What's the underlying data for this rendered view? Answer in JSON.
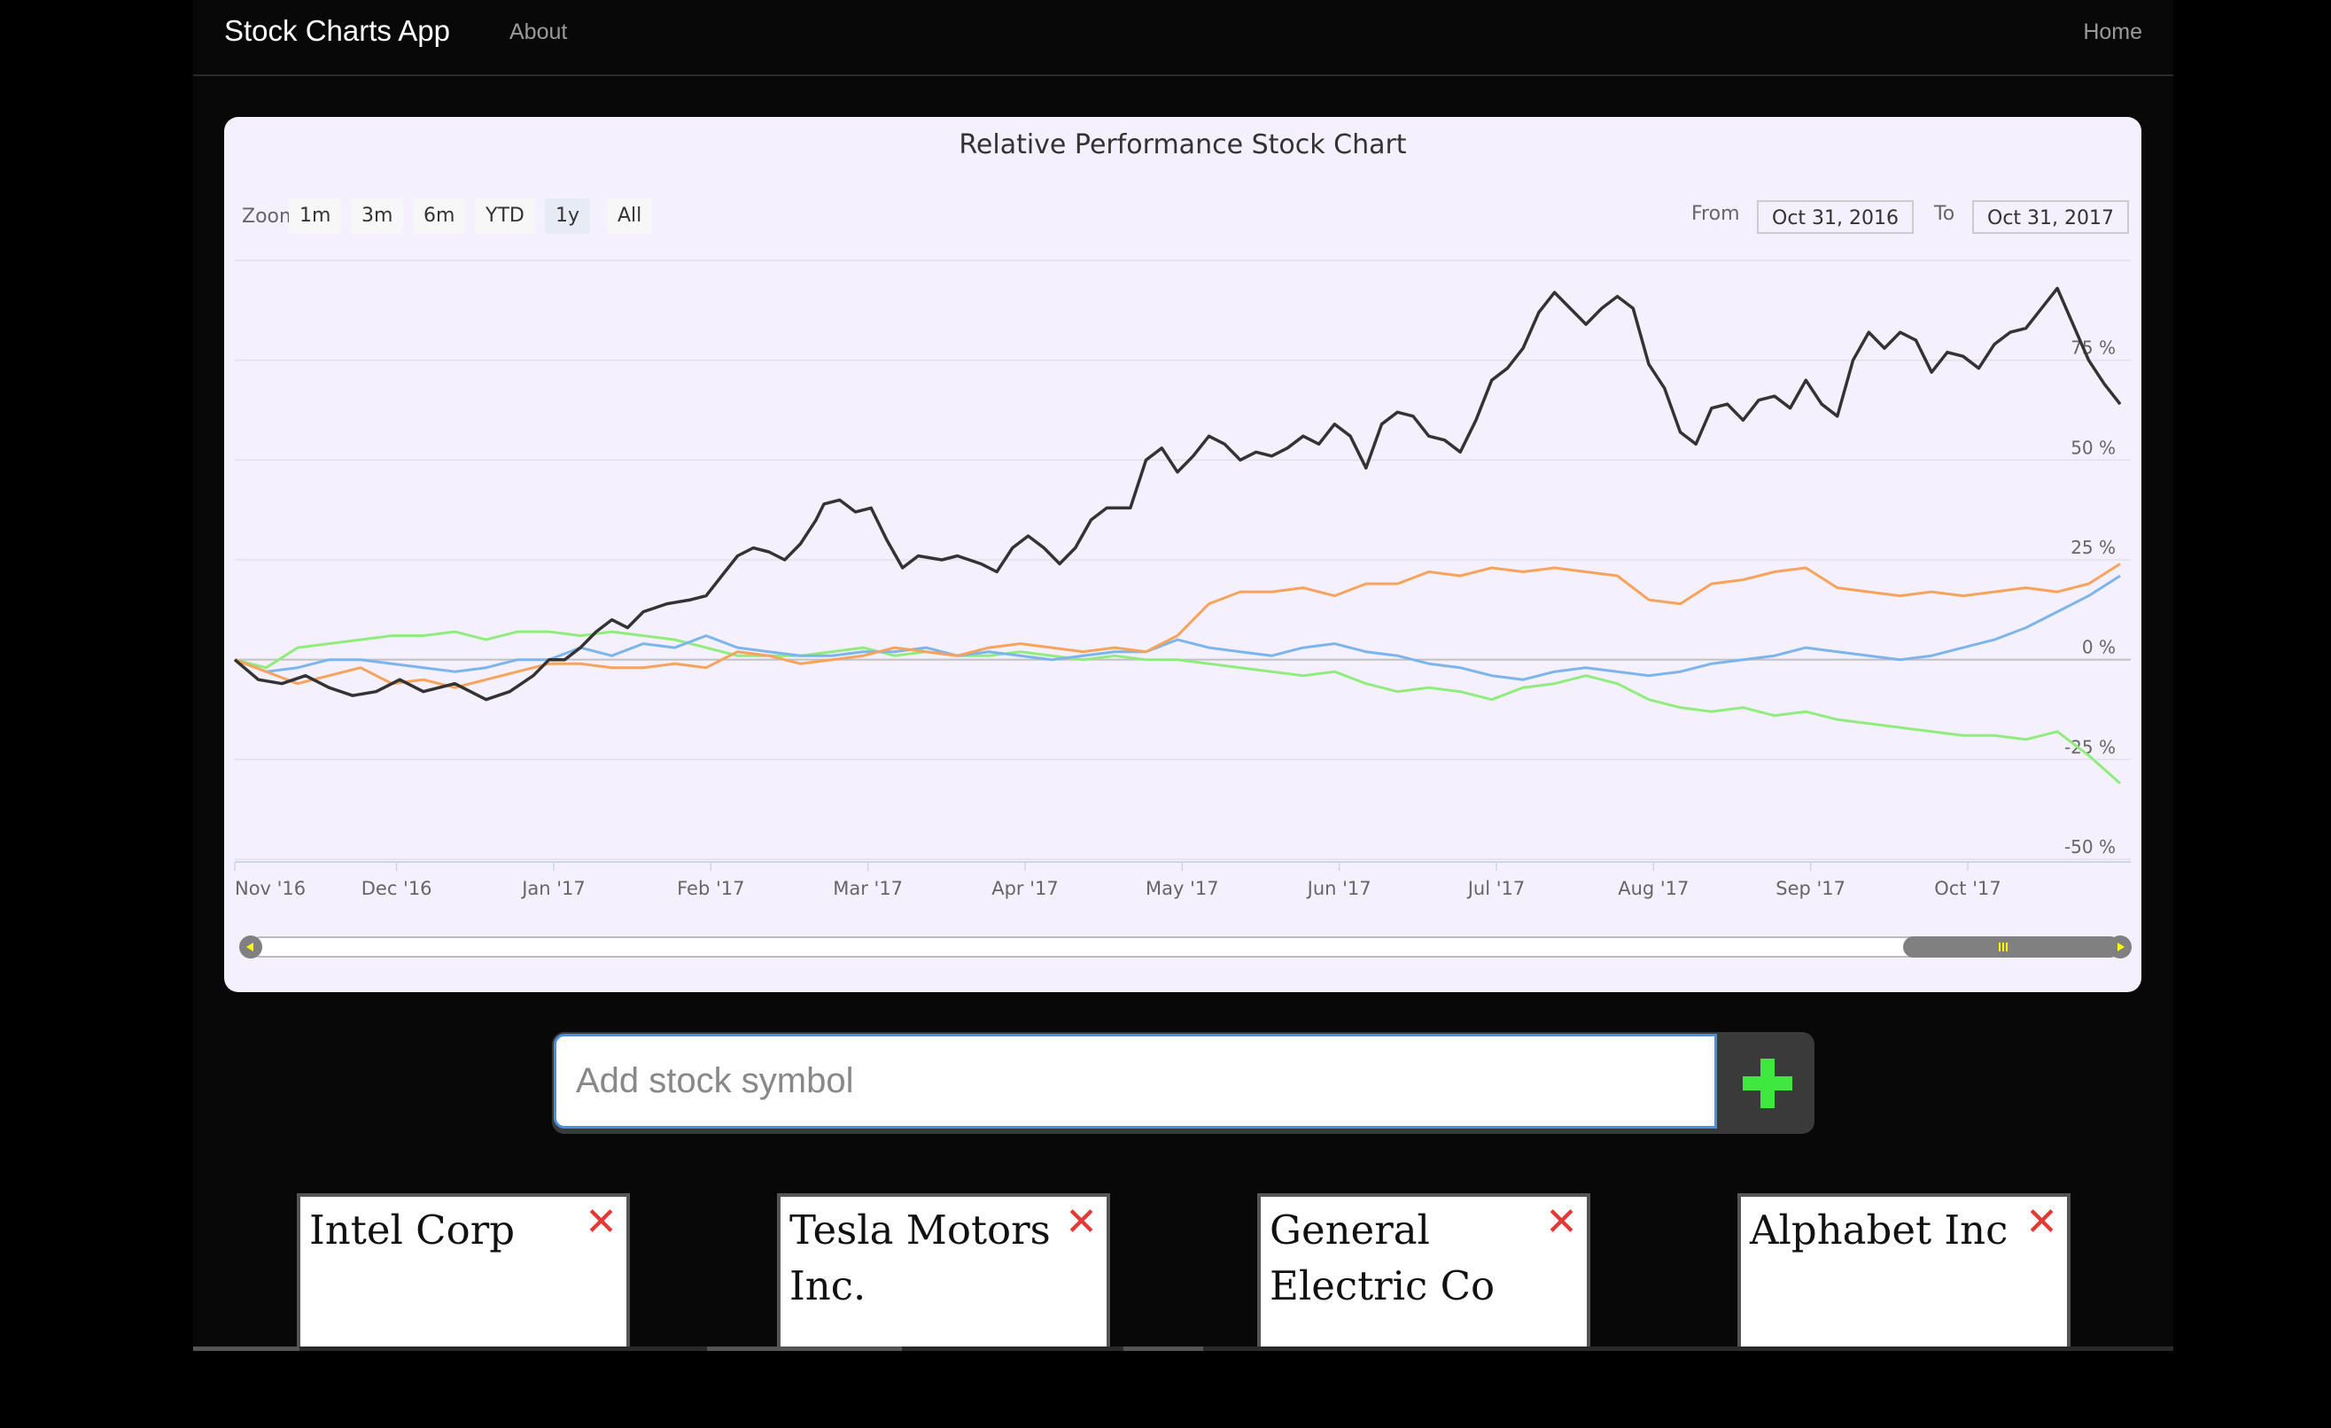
{
  "navbar": {
    "brand": "Stock Charts App",
    "about": "About",
    "home": "Home"
  },
  "chart": {
    "title": "Relative Performance Stock Chart",
    "zoom_label": "Zoom",
    "zoom_buttons": [
      "1m",
      "3m",
      "6m",
      "YTD",
      "1y",
      "All"
    ],
    "active_zoom": "1y",
    "from_label": "From",
    "from_date": "Oct 31, 2016",
    "to_label": "To",
    "to_date": "Oct 31, 2017"
  },
  "chart_data": {
    "type": "line",
    "title": "Relative Performance Stock Chart",
    "x_tick_labels": [
      "Nov '16",
      "Dec '16",
      "Jan '17",
      "Feb '17",
      "Mar '17",
      "Apr '17",
      "May '17",
      "Jun '17",
      "Jul '17",
      "Aug '17",
      "Sep '17",
      "Oct '17"
    ],
    "y_tick_labels": [
      "-50 %",
      "-25 %",
      "0 %",
      "25 %",
      "50 %",
      "75 %"
    ],
    "ylim": [
      -50,
      100
    ],
    "x_unit": "months since Oct 31, 2016",
    "grid": true,
    "series": [
      {
        "color": "#333333",
        "points": [
          [
            0,
            0
          ],
          [
            0.15,
            -5
          ],
          [
            0.3,
            -6
          ],
          [
            0.45,
            -4
          ],
          [
            0.6,
            -7
          ],
          [
            0.75,
            -9
          ],
          [
            0.9,
            -8
          ],
          [
            1.05,
            -5
          ],
          [
            1.2,
            -8
          ],
          [
            1.4,
            -6
          ],
          [
            1.6,
            -10
          ],
          [
            1.75,
            -8
          ],
          [
            1.9,
            -4
          ],
          [
            2.0,
            0
          ],
          [
            2.1,
            0
          ],
          [
            2.2,
            3
          ],
          [
            2.3,
            7
          ],
          [
            2.4,
            10
          ],
          [
            2.5,
            8
          ],
          [
            2.6,
            12
          ],
          [
            2.75,
            14
          ],
          [
            2.9,
            15
          ],
          [
            3.0,
            16
          ],
          [
            3.1,
            21
          ],
          [
            3.2,
            26
          ],
          [
            3.3,
            28
          ],
          [
            3.4,
            27
          ],
          [
            3.5,
            25
          ],
          [
            3.6,
            29
          ],
          [
            3.7,
            35
          ],
          [
            3.75,
            39
          ],
          [
            3.85,
            40
          ],
          [
            3.95,
            37
          ],
          [
            4.05,
            38
          ],
          [
            4.15,
            30
          ],
          [
            4.25,
            23
          ],
          [
            4.35,
            26
          ],
          [
            4.5,
            25
          ],
          [
            4.6,
            26
          ],
          [
            4.75,
            24
          ],
          [
            4.85,
            22
          ],
          [
            4.95,
            28
          ],
          [
            5.05,
            31
          ],
          [
            5.15,
            28
          ],
          [
            5.25,
            24
          ],
          [
            5.35,
            28
          ],
          [
            5.45,
            35
          ],
          [
            5.55,
            38
          ],
          [
            5.7,
            38
          ],
          [
            5.8,
            50
          ],
          [
            5.9,
            53
          ],
          [
            6.0,
            47
          ],
          [
            6.1,
            51
          ],
          [
            6.2,
            56
          ],
          [
            6.3,
            54
          ],
          [
            6.4,
            50
          ],
          [
            6.5,
            52
          ],
          [
            6.6,
            51
          ],
          [
            6.7,
            53
          ],
          [
            6.8,
            56
          ],
          [
            6.9,
            54
          ],
          [
            7.0,
            59
          ],
          [
            7.1,
            56
          ],
          [
            7.2,
            48
          ],
          [
            7.3,
            59
          ],
          [
            7.4,
            62
          ],
          [
            7.5,
            61
          ],
          [
            7.6,
            56
          ],
          [
            7.7,
            55
          ],
          [
            7.8,
            52
          ],
          [
            7.9,
            60
          ],
          [
            8.0,
            70
          ],
          [
            8.1,
            73
          ],
          [
            8.2,
            78
          ],
          [
            8.3,
            87
          ],
          [
            8.4,
            92
          ],
          [
            8.5,
            88
          ],
          [
            8.6,
            84
          ],
          [
            8.7,
            88
          ],
          [
            8.8,
            91
          ],
          [
            8.9,
            88
          ],
          [
            9.0,
            74
          ],
          [
            9.1,
            68
          ],
          [
            9.2,
            57
          ],
          [
            9.3,
            54
          ],
          [
            9.4,
            63
          ],
          [
            9.5,
            64
          ],
          [
            9.6,
            60
          ],
          [
            9.7,
            65
          ],
          [
            9.8,
            66
          ],
          [
            9.9,
            63
          ],
          [
            10.0,
            70
          ],
          [
            10.1,
            64
          ],
          [
            10.2,
            61
          ],
          [
            10.3,
            75
          ],
          [
            10.4,
            82
          ],
          [
            10.5,
            78
          ],
          [
            10.6,
            82
          ],
          [
            10.7,
            80
          ],
          [
            10.8,
            72
          ],
          [
            10.9,
            77
          ],
          [
            11.0,
            76
          ],
          [
            11.1,
            73
          ],
          [
            11.2,
            79
          ],
          [
            11.3,
            82
          ],
          [
            11.4,
            83
          ],
          [
            11.5,
            88
          ],
          [
            11.6,
            93
          ],
          [
            11.7,
            84
          ],
          [
            11.8,
            75
          ],
          [
            11.9,
            69
          ],
          [
            12.0,
            64
          ]
        ]
      },
      {
        "color": "#f7a35c",
        "points": [
          [
            0,
            0
          ],
          [
            0.2,
            -3
          ],
          [
            0.4,
            -6
          ],
          [
            0.6,
            -4
          ],
          [
            0.8,
            -2
          ],
          [
            1.0,
            -6
          ],
          [
            1.2,
            -5
          ],
          [
            1.4,
            -7
          ],
          [
            1.6,
            -5
          ],
          [
            1.8,
            -3
          ],
          [
            2.0,
            -1
          ],
          [
            2.2,
            -1
          ],
          [
            2.4,
            -2
          ],
          [
            2.6,
            -2
          ],
          [
            2.8,
            -1
          ],
          [
            3.0,
            -2
          ],
          [
            3.2,
            2
          ],
          [
            3.4,
            1
          ],
          [
            3.6,
            -1
          ],
          [
            3.8,
            0
          ],
          [
            4.0,
            1
          ],
          [
            4.2,
            3
          ],
          [
            4.4,
            2
          ],
          [
            4.6,
            1
          ],
          [
            4.8,
            3
          ],
          [
            5.0,
            4
          ],
          [
            5.2,
            3
          ],
          [
            5.4,
            2
          ],
          [
            5.6,
            3
          ],
          [
            5.8,
            2
          ],
          [
            6.0,
            6
          ],
          [
            6.2,
            14
          ],
          [
            6.4,
            17
          ],
          [
            6.6,
            17
          ],
          [
            6.8,
            18
          ],
          [
            7.0,
            16
          ],
          [
            7.2,
            19
          ],
          [
            7.4,
            19
          ],
          [
            7.6,
            22
          ],
          [
            7.8,
            21
          ],
          [
            8.0,
            23
          ],
          [
            8.2,
            22
          ],
          [
            8.4,
            23
          ],
          [
            8.6,
            22
          ],
          [
            8.8,
            21
          ],
          [
            9.0,
            15
          ],
          [
            9.2,
            14
          ],
          [
            9.4,
            19
          ],
          [
            9.6,
            20
          ],
          [
            9.8,
            22
          ],
          [
            10.0,
            23
          ],
          [
            10.2,
            18
          ],
          [
            10.4,
            17
          ],
          [
            10.6,
            16
          ],
          [
            10.8,
            17
          ],
          [
            11.0,
            16
          ],
          [
            11.2,
            17
          ],
          [
            11.4,
            18
          ],
          [
            11.6,
            17
          ],
          [
            11.8,
            19
          ],
          [
            12.0,
            24
          ]
        ]
      },
      {
        "color": "#7cb5ec",
        "points": [
          [
            0,
            0
          ],
          [
            0.2,
            -3
          ],
          [
            0.4,
            -2
          ],
          [
            0.6,
            0
          ],
          [
            0.8,
            0
          ],
          [
            1.0,
            -1
          ],
          [
            1.2,
            -2
          ],
          [
            1.4,
            -3
          ],
          [
            1.6,
            -2
          ],
          [
            1.8,
            0
          ],
          [
            2.0,
            0
          ],
          [
            2.2,
            3
          ],
          [
            2.4,
            1
          ],
          [
            2.6,
            4
          ],
          [
            2.8,
            3
          ],
          [
            3.0,
            6
          ],
          [
            3.2,
            3
          ],
          [
            3.4,
            2
          ],
          [
            3.6,
            1
          ],
          [
            3.8,
            1
          ],
          [
            4.0,
            2
          ],
          [
            4.2,
            2
          ],
          [
            4.4,
            3
          ],
          [
            4.6,
            1
          ],
          [
            4.8,
            2
          ],
          [
            5.0,
            1
          ],
          [
            5.2,
            0
          ],
          [
            5.4,
            1
          ],
          [
            5.6,
            2
          ],
          [
            5.8,
            2
          ],
          [
            6.0,
            5
          ],
          [
            6.2,
            3
          ],
          [
            6.4,
            2
          ],
          [
            6.6,
            1
          ],
          [
            6.8,
            3
          ],
          [
            7.0,
            4
          ],
          [
            7.2,
            2
          ],
          [
            7.4,
            1
          ],
          [
            7.6,
            -1
          ],
          [
            7.8,
            -2
          ],
          [
            8.0,
            -4
          ],
          [
            8.2,
            -5
          ],
          [
            8.4,
            -3
          ],
          [
            8.6,
            -2
          ],
          [
            8.8,
            -3
          ],
          [
            9.0,
            -4
          ],
          [
            9.2,
            -3
          ],
          [
            9.4,
            -1
          ],
          [
            9.6,
            0
          ],
          [
            9.8,
            1
          ],
          [
            10.0,
            3
          ],
          [
            10.2,
            2
          ],
          [
            10.4,
            1
          ],
          [
            10.6,
            0
          ],
          [
            10.8,
            1
          ],
          [
            11.0,
            3
          ],
          [
            11.2,
            5
          ],
          [
            11.4,
            8
          ],
          [
            11.6,
            12
          ],
          [
            11.8,
            16
          ],
          [
            12.0,
            21
          ]
        ]
      },
      {
        "color": "#90ed7d",
        "points": [
          [
            0,
            0
          ],
          [
            0.2,
            -2
          ],
          [
            0.4,
            3
          ],
          [
            0.6,
            4
          ],
          [
            0.8,
            5
          ],
          [
            1.0,
            6
          ],
          [
            1.2,
            6
          ],
          [
            1.4,
            7
          ],
          [
            1.6,
            5
          ],
          [
            1.8,
            7
          ],
          [
            2.0,
            7
          ],
          [
            2.2,
            6
          ],
          [
            2.4,
            7
          ],
          [
            2.6,
            6
          ],
          [
            2.8,
            5
          ],
          [
            3.0,
            3
          ],
          [
            3.2,
            1
          ],
          [
            3.4,
            1
          ],
          [
            3.6,
            1
          ],
          [
            3.8,
            2
          ],
          [
            4.0,
            3
          ],
          [
            4.2,
            1
          ],
          [
            4.4,
            2
          ],
          [
            4.6,
            1
          ],
          [
            4.8,
            1
          ],
          [
            5.0,
            2
          ],
          [
            5.2,
            1
          ],
          [
            5.4,
            0
          ],
          [
            5.6,
            1
          ],
          [
            5.8,
            0
          ],
          [
            6.0,
            0
          ],
          [
            6.2,
            -1
          ],
          [
            6.4,
            -2
          ],
          [
            6.6,
            -3
          ],
          [
            6.8,
            -4
          ],
          [
            7.0,
            -3
          ],
          [
            7.2,
            -6
          ],
          [
            7.4,
            -8
          ],
          [
            7.6,
            -7
          ],
          [
            7.8,
            -8
          ],
          [
            8.0,
            -10
          ],
          [
            8.2,
            -7
          ],
          [
            8.4,
            -6
          ],
          [
            8.6,
            -4
          ],
          [
            8.8,
            -6
          ],
          [
            9.0,
            -10
          ],
          [
            9.2,
            -12
          ],
          [
            9.4,
            -13
          ],
          [
            9.6,
            -12
          ],
          [
            9.8,
            -14
          ],
          [
            10.0,
            -13
          ],
          [
            10.2,
            -15
          ],
          [
            10.4,
            -16
          ],
          [
            10.6,
            -17
          ],
          [
            10.8,
            -18
          ],
          [
            11.0,
            -19
          ],
          [
            11.2,
            -19
          ],
          [
            11.4,
            -20
          ],
          [
            11.6,
            -18
          ],
          [
            11.8,
            -24
          ],
          [
            12.0,
            -31
          ]
        ]
      }
    ]
  },
  "search": {
    "placeholder": "Add stock symbol",
    "value": ""
  },
  "stocks": [
    {
      "name": "Intel Corp"
    },
    {
      "name": "Tesla Motors Inc."
    },
    {
      "name": "General Electric Co"
    },
    {
      "name": "Alphabet Inc"
    }
  ],
  "icons": {
    "add": "plus-icon",
    "remove": "close-icon"
  },
  "colors": {
    "add_icon": "#3ee83e",
    "remove_icon": "#e53935",
    "input_border": "#4a90e2"
  }
}
